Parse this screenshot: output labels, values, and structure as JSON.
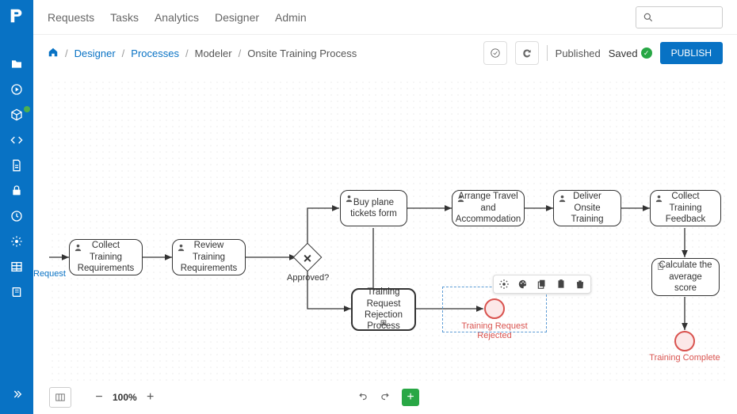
{
  "nav": {
    "requests": "Requests",
    "tasks": "Tasks",
    "analytics": "Analytics",
    "designer": "Designer",
    "admin": "Admin"
  },
  "search": {
    "placeholder": ""
  },
  "breadcrumb": {
    "designer": "Designer",
    "processes": "Processes",
    "modeler": "Modeler",
    "current": "Onsite Training Process"
  },
  "status": {
    "published": "Published",
    "saved": "Saved"
  },
  "actions": {
    "publish": "PUBLISH"
  },
  "canvas": {
    "start_label": "Request",
    "tasks": {
      "t1": "Collect Training Requirements",
      "t2": "Review Training Requirements",
      "t3": "Buy plane tickets form",
      "t4": "Training Request Rejection Process",
      "t5": "Arrange Travel and Accommodation",
      "t6": "Deliver Onsite Training",
      "t7": "Collect Training Feedback",
      "t8": "Calculate the average score"
    },
    "gateway_label": "Approved?",
    "end1_label": "Training Request Rejected",
    "end2_label": "Training Complete"
  },
  "zoom": "100%"
}
